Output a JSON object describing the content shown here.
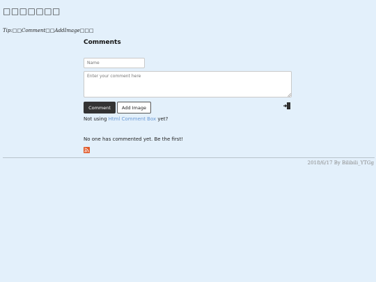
{
  "header": {
    "title": "□□□□□□□"
  },
  "tip": {
    "text": "Tip:□□Comment□□AddImage□□□"
  },
  "comments": {
    "heading": "Comments",
    "name_placeholder": "Name",
    "comment_placeholder": "Enter your comment here",
    "comment_button": "Comment",
    "add_image_button": "Add Image",
    "not_using_prefix": "Not using",
    "not_using_link": "Html Comment Box",
    "not_using_suffix": "yet?",
    "empty_message": "No one has commented yet. Be the first!"
  },
  "icons": {
    "login": "login-icon",
    "rss": "rss-icon",
    "rss_color": "#e05a2b"
  },
  "footer": {
    "text": "2018/6/17 By Bilibili_YTGg"
  }
}
